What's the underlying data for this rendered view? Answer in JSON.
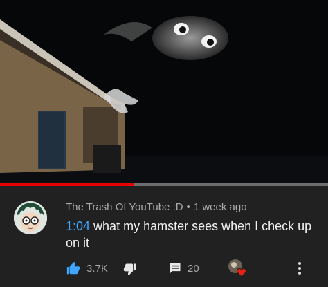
{
  "comment": {
    "author": "The Trash Of YouTube :D",
    "separator": "•",
    "age": "1 week ago",
    "timestamp": "1:04",
    "text": " what my hamster sees when I check up on it",
    "likes": "3.7K",
    "replies": "20"
  },
  "video": {
    "progress_fraction": 0.41
  },
  "icons": {
    "like": "thumbs-up-icon",
    "dislike": "thumbs-down-icon",
    "reply": "comment-icon",
    "heart": "creator-heart-icon",
    "more": "more-vert-icon"
  },
  "colors": {
    "background": "#212121",
    "like_active": "#3ea6ff",
    "timestamp_link": "#3ea6ff",
    "progress_played": "#e60000",
    "heart": "#e62117"
  }
}
